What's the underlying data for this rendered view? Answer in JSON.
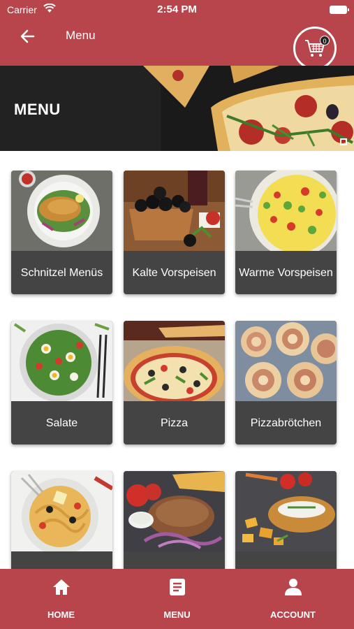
{
  "status_bar": {
    "carrier": "Carrier",
    "time": "2:54 PM"
  },
  "header": {
    "title": "Menu",
    "back_icon": "arrow-left-icon",
    "cart_icon": "shopping-cart-icon",
    "cart_count": "0"
  },
  "banner": {
    "title": "MENU"
  },
  "categories": [
    {
      "label": "Schnitzel Menüs"
    },
    {
      "label": "Kalte Vorspeisen"
    },
    {
      "label": "Warme Vorspeisen"
    },
    {
      "label": "Salate"
    },
    {
      "label": "Pizza"
    },
    {
      "label": "Pizzabrötchen"
    },
    {
      "label": ""
    },
    {
      "label": ""
    },
    {
      "label": ""
    }
  ],
  "bottom_nav": {
    "items": [
      {
        "label": "HOME",
        "icon": "home-icon"
      },
      {
        "label": "MENU",
        "icon": "menu-document-icon"
      },
      {
        "label": "ACCOUNT",
        "icon": "user-icon"
      }
    ]
  },
  "colors": {
    "primary": "#b8454b",
    "card_label_bg": "#444444",
    "banner_bg": "#191919"
  }
}
